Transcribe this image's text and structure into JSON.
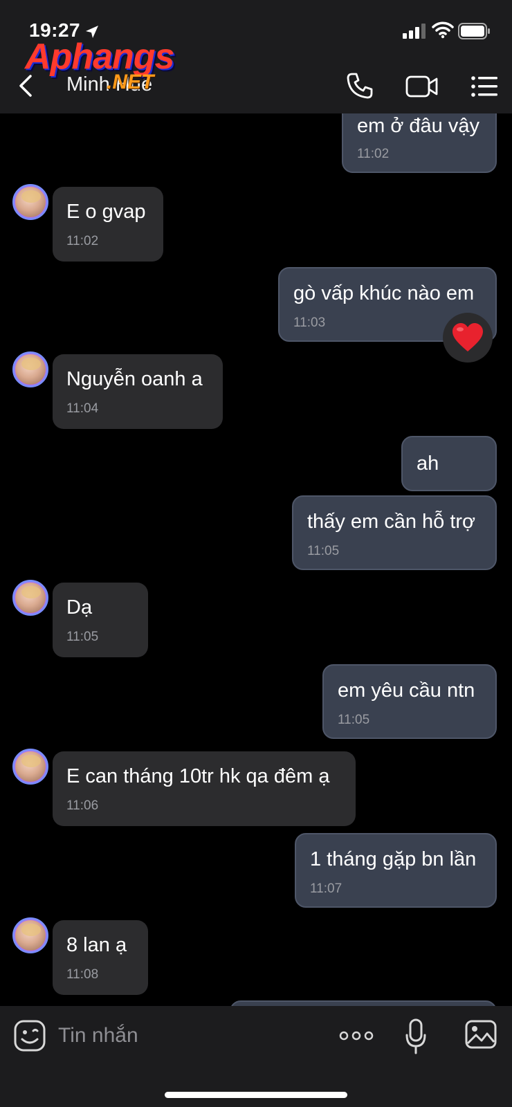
{
  "status_bar": {
    "time": "19:27"
  },
  "watermark": {
    "main": "Aphangs",
    "sub": ".NET"
  },
  "header": {
    "contact_name": "Minh Huê"
  },
  "messages": [
    {
      "dir": "out",
      "text": "em ở đâu vậy",
      "time": "11:02"
    },
    {
      "dir": "in",
      "text": "E o gvap",
      "time": "11:02"
    },
    {
      "dir": "out",
      "text": "gò vấp khúc nào em",
      "time": "11:03",
      "reaction": "❤️"
    },
    {
      "dir": "in",
      "text": "Nguyễn oanh a",
      "time": "11:04"
    },
    {
      "dir": "out",
      "text": "ah",
      "time": ""
    },
    {
      "dir": "out",
      "text": "thấy em cần hỗ trợ",
      "time": "11:05"
    },
    {
      "dir": "in",
      "text": "Dạ",
      "time": "11:05"
    },
    {
      "dir": "out",
      "text": "em yêu cầu ntn",
      "time": "11:05"
    },
    {
      "dir": "in",
      "text": "E can tháng 10tr hk qa đêm ạ",
      "time": "11:06"
    },
    {
      "dir": "out",
      "text": "1 tháng gặp bn lần",
      "time": "11:07"
    },
    {
      "dir": "in",
      "text": "8 lan ạ",
      "time": "11:08"
    }
  ],
  "composer": {
    "placeholder": "Tin nhắn"
  },
  "colors": {
    "header_bg": "#1c1c1e",
    "incoming_bubble": "#2c2c2e",
    "outgoing_bubble": "#3a4150",
    "chat_bg": "#000000"
  },
  "icons": [
    "back-icon",
    "call-icon",
    "video-icon",
    "menu-icon",
    "emoji-icon",
    "more-icon",
    "mic-icon",
    "gallery-icon",
    "heart-icon"
  ]
}
